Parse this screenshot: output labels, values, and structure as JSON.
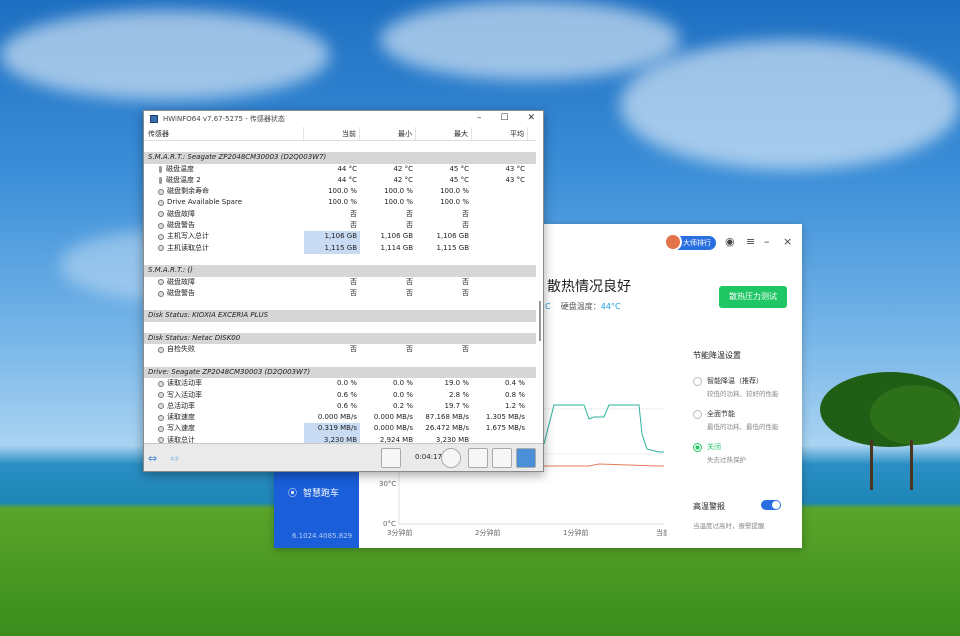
{
  "hwinfo": {
    "title": "HWiNFO64 v7.67-5275 - 传感器状态",
    "columns": [
      "传感器",
      "当前",
      "最小",
      "最大",
      "平均"
    ],
    "rows": [
      {
        "type": "spacer"
      },
      {
        "type": "group",
        "label": "S.M.A.R.T.: Seagate ZP2048CM30003 (D2Q003W7)"
      },
      {
        "type": "item",
        "icon": "thermometer-icon",
        "label": "磁盘温度",
        "v": [
          "44 °C",
          "42 °C",
          "45 °C",
          "43 °C"
        ]
      },
      {
        "type": "item",
        "icon": "thermometer-icon",
        "label": "磁盘温度 2",
        "v": [
          "44 °C",
          "42 °C",
          "45 °C",
          "43 °C"
        ]
      },
      {
        "type": "item",
        "icon": "status-icon",
        "label": "磁盘剩余寿命",
        "v": [
          "100.0 %",
          "100.0 %",
          "100.0 %",
          ""
        ]
      },
      {
        "type": "item",
        "icon": "status-icon",
        "label": "Drive Available Spare",
        "v": [
          "100.0 %",
          "100.0 %",
          "100.0 %",
          ""
        ]
      },
      {
        "type": "item",
        "icon": "status-icon",
        "label": "磁盘故障",
        "v": [
          "否",
          "否",
          "否",
          ""
        ]
      },
      {
        "type": "item",
        "icon": "status-icon",
        "label": "磁盘警告",
        "v": [
          "否",
          "否",
          "否",
          ""
        ]
      },
      {
        "type": "item",
        "icon": "status-icon",
        "label": "主机写入总计",
        "v": [
          "1,106 GB",
          "1,106 GB",
          "1,106 GB",
          ""
        ],
        "hl": true
      },
      {
        "type": "item",
        "icon": "status-icon",
        "label": "主机读取总计",
        "v": [
          "1,115 GB",
          "1,114 GB",
          "1,115 GB",
          ""
        ],
        "hl": true
      },
      {
        "type": "spacer"
      },
      {
        "type": "group",
        "label": "S.M.A.R.T.: ()"
      },
      {
        "type": "item",
        "icon": "status-icon",
        "label": "磁盘故障",
        "v": [
          "否",
          "否",
          "否",
          ""
        ]
      },
      {
        "type": "item",
        "icon": "status-icon",
        "label": "磁盘警告",
        "v": [
          "否",
          "否",
          "否",
          ""
        ]
      },
      {
        "type": "spacer"
      },
      {
        "type": "group",
        "label": "Disk Status: KIOXIA EXCERIA PLUS"
      },
      {
        "type": "spacer"
      },
      {
        "type": "group",
        "label": "Disk Status: Netac DISK00"
      },
      {
        "type": "item",
        "icon": "status-icon",
        "label": "自检失败",
        "v": [
          "否",
          "否",
          "否",
          ""
        ]
      },
      {
        "type": "spacer"
      },
      {
        "type": "group",
        "label": "Drive: Seagate ZP2048CM30003 (D2Q003W7)"
      },
      {
        "type": "item",
        "icon": "status-icon",
        "label": "读取活动率",
        "v": [
          "0.0 %",
          "0.0 %",
          "19.0 %",
          "0.4 %"
        ]
      },
      {
        "type": "item",
        "icon": "status-icon",
        "label": "写入活动率",
        "v": [
          "0.6 %",
          "0.0 %",
          "2.8 %",
          "0.8 %"
        ]
      },
      {
        "type": "item",
        "icon": "status-icon",
        "label": "总活动率",
        "v": [
          "0.6 %",
          "0.2 %",
          "19.7 %",
          "1.2 %"
        ]
      },
      {
        "type": "item",
        "icon": "status-icon",
        "label": "读取速度",
        "v": [
          "0.000 MB/s",
          "0.000 MB/s",
          "87.168 MB/s",
          "1.305 MB/s"
        ]
      },
      {
        "type": "item",
        "icon": "status-icon",
        "label": "写入速度",
        "v": [
          "0.319 MB/s",
          "0.000 MB/s",
          "26.472 MB/s",
          "1.675 MB/s"
        ],
        "hl": true
      },
      {
        "type": "item",
        "icon": "status-icon",
        "label": "读取总计",
        "v": [
          "3,230 MB",
          "2,924 MB",
          "3,230 MB",
          ""
        ],
        "hl": true
      }
    ],
    "timer": "0:04:17"
  },
  "app": {
    "rank_label": "大师排行",
    "status_title": "散热情况良好",
    "status_sub_prefix": "硬盘温度：",
    "status_sub_value": "44°C",
    "status_sub_left": "C",
    "stress_button": "散热压力测试",
    "power_title": "节能降温设置",
    "options": [
      {
        "title": "智能降温（推荐）",
        "desc": "较低的功耗、较好的性能",
        "selected": false
      },
      {
        "title": "全面节能",
        "desc": "最低的功耗、最低的性能",
        "selected": false
      },
      {
        "title": "关闭",
        "desc": "失去过热保护",
        "selected": true
      }
    ],
    "alarm_title": "高温警报",
    "alarm_desc": "当温度过高时，报警提醒",
    "alarm_on": true,
    "nav_label": "智慧跑车",
    "version": "6.1024.4085.829"
  },
  "chart_data": {
    "type": "line",
    "y_ticks": [
      "30°C",
      "0°C"
    ],
    "x_ticks": [
      "3分钟前",
      "2分钟前",
      "1分钟前",
      "当前"
    ],
    "colors": {
      "load": "#2bb39b",
      "temp": "#e57b5a"
    }
  }
}
